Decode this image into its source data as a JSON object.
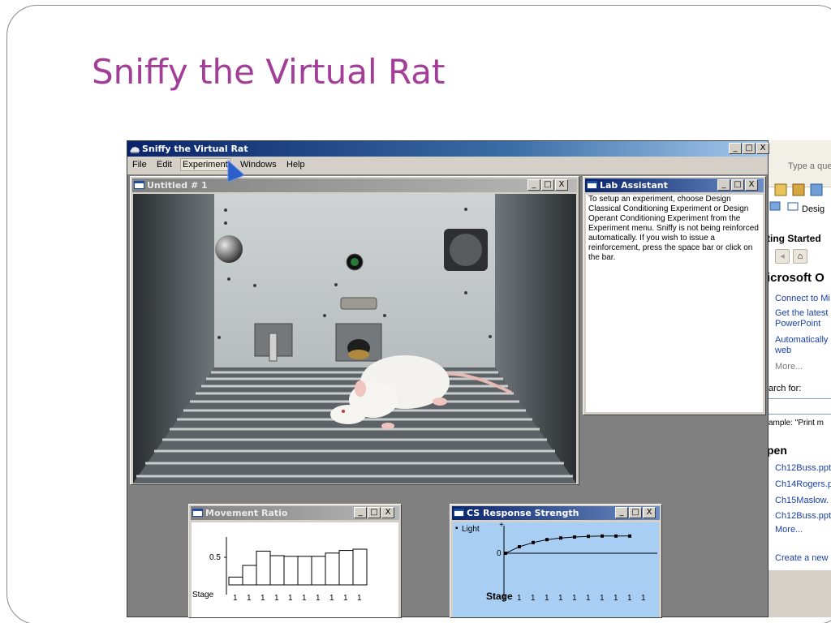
{
  "slide": {
    "title": "Sniffy the Virtual Rat"
  },
  "app": {
    "title": "Sniffy the Virtual Rat",
    "menus": [
      "File",
      "Edit",
      "Experiment",
      "Windows",
      "Help"
    ],
    "active_menu": "Experiment",
    "window_controls": [
      "_",
      "□",
      "X"
    ]
  },
  "windows": {
    "chamber": {
      "title": "Untitled # 1"
    },
    "lab_assistant": {
      "title": "Lab Assistant",
      "text": "To setup an experiment, choose Design Classical Conditioning Experiment or Design Operant Conditioning Experiment from the Experiment menu.  Sniffy is not being reinforced automatically. If you wish to issue a reinforcement, press the space bar or click on the bar."
    },
    "movement_ratio": {
      "title": "Movement Ratio",
      "y_label": "0.5",
      "stage_label": "Stage",
      "stage_values": [
        "1",
        "1",
        "1",
        "1",
        "1",
        "1",
        "1",
        "1",
        "1",
        "1"
      ],
      "bar_values": [
        0.12,
        0.3,
        0.52,
        0.45,
        0.44,
        0.44,
        0.44,
        0.49,
        0.53,
        0.55
      ]
    },
    "cs_response": {
      "title": "CS Response Strength",
      "series_label": "Light",
      "plus_label": "+",
      "zero_label": "0",
      "minus_label": "–",
      "stage_label": "Stage",
      "stage_values": [
        "1",
        "1",
        "1",
        "1",
        "1",
        "1",
        "1",
        "1",
        "1",
        "1"
      ],
      "curve_values": [
        0.0,
        0.2,
        0.33,
        0.42,
        0.47,
        0.5,
        0.52,
        0.53,
        0.53,
        0.53
      ]
    }
  },
  "office_panel": {
    "search_placeholder": "Type a que",
    "toolbar_label": "Desig",
    "section_title": "ting Started",
    "heading": "icrosoft O",
    "links": [
      "Connect to Mi",
      "Get the latest",
      "PowerPoint",
      "Automatically",
      "web"
    ],
    "more": "More...",
    "search_for": "arch for:",
    "example": "ample: \"Print m",
    "open_heading": "pen",
    "files": [
      "Ch12Buss.ppt",
      "Ch14Rogers.p",
      "Ch15Maslow.",
      "Ch12Buss.ppt"
    ],
    "files_more": "More...",
    "create_new": "Create a new"
  },
  "colors": {
    "title_accent": "#a33e98",
    "active_titlebar": "#0a246a",
    "chart_bg": "#a9cef4"
  }
}
